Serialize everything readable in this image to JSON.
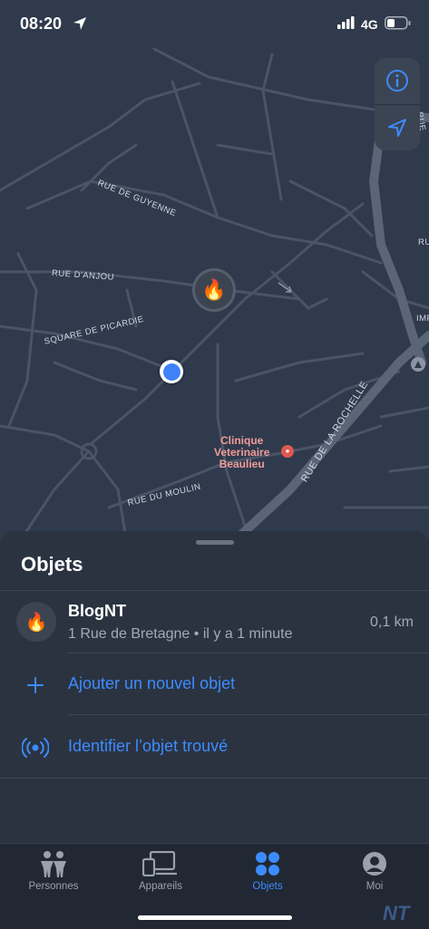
{
  "status_bar": {
    "time": "08:20",
    "network": "4G"
  },
  "map": {
    "streets": [
      "RUE DE GUYENNE",
      "RUE D'ANJOU",
      "SQUARE DE PICARDIE",
      "RUE DU MOULIN",
      "RUE DE LA ROCHELLE",
      "RUE",
      "RUE",
      "IMP"
    ],
    "poi": {
      "line1": "Clinique",
      "line2": "Veterinaire",
      "line3": "Beaulieu",
      "icon": "paw-icon"
    },
    "item_pin_icon": "fire-emoji",
    "controls": [
      "info-icon",
      "location-arrow-icon"
    ]
  },
  "sheet": {
    "title": "Objets",
    "item": {
      "emoji": "🔥",
      "name": "BlogNT",
      "subtitle": "1 Rue de Bretagne • il y a 1 minute",
      "distance": "0,1 km"
    },
    "actions": [
      {
        "label": "Ajouter un nouvel objet",
        "icon": "plus-icon"
      },
      {
        "label": "Identifier l’objet trouvé",
        "icon": "airtag-signal-icon"
      }
    ]
  },
  "tabs": [
    {
      "label": "Personnes",
      "icon": "people-icon",
      "active": false
    },
    {
      "label": "Appareils",
      "icon": "devices-icon",
      "active": false
    },
    {
      "label": "Objets",
      "icon": "items-grid-icon",
      "active": true
    },
    {
      "label": "Moi",
      "icon": "person-circle-icon",
      "active": false
    }
  ],
  "colors": {
    "accent": "#3c8cff",
    "map_bg": "#2f3a4c",
    "road": "#556073",
    "sheet_bg": "#2b3341"
  },
  "watermark": "NT"
}
